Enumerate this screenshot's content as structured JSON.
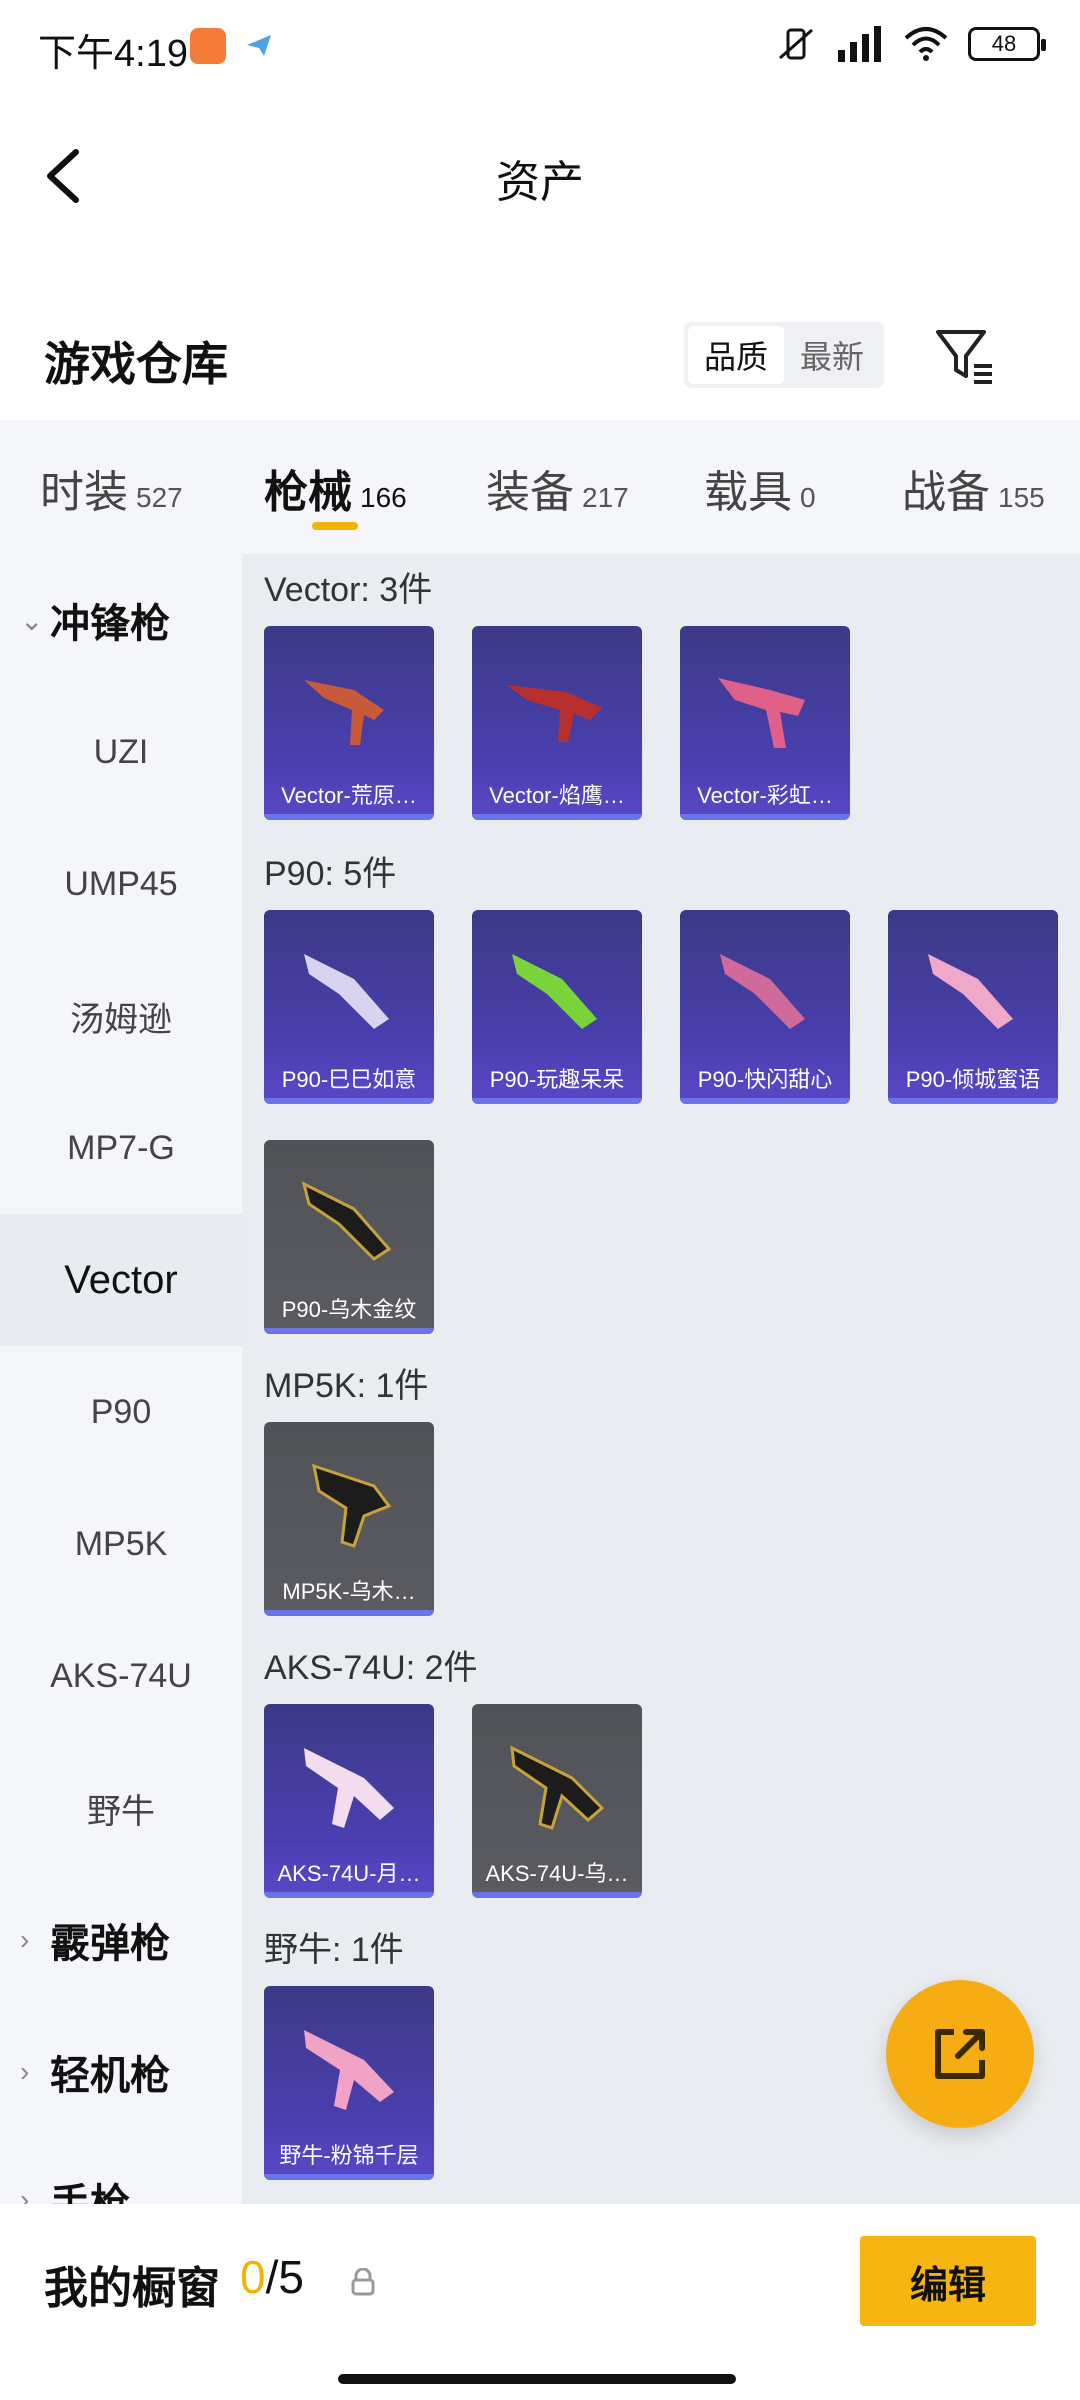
{
  "status": {
    "time": "下午4:19",
    "battery": "48"
  },
  "header": {
    "title": "资产"
  },
  "warehouse": {
    "title": "游戏仓库",
    "sort_options": [
      "品质",
      "最新"
    ],
    "active_sort": "品质"
  },
  "tabs": [
    {
      "label": "时装",
      "count": "527"
    },
    {
      "label": "枪械",
      "count": "166",
      "active": true
    },
    {
      "label": "装备",
      "count": "217"
    },
    {
      "label": "载具",
      "count": "0"
    },
    {
      "label": "战备",
      "count": "155"
    }
  ],
  "sidebar": {
    "group_smg": "冲锋枪",
    "items": [
      "UZI",
      "UMP45",
      "汤姆逊",
      "MP7-G",
      "Vector",
      "P90",
      "MP5K",
      "AKS-74U",
      "野牛"
    ],
    "active_item": "Vector",
    "group_shotgun": "霰弹枪",
    "group_lmg": "轻机枪",
    "group_pistol": "手枪"
  },
  "sections": [
    {
      "title": "Vector: 3件",
      "items": [
        "Vector-荒原…",
        "Vector-焰鹰…",
        "Vector-彩虹…"
      ]
    },
    {
      "title": "P90: 5件",
      "items": [
        "P90-巳巳如意",
        "P90-玩趣呆呆",
        "P90-快闪甜心",
        "P90-倾城蜜语",
        "P90-乌木金纹"
      ]
    },
    {
      "title": "MP5K: 1件",
      "items": [
        "MP5K-乌木…"
      ]
    },
    {
      "title": "AKS-74U: 2件",
      "items": [
        "AKS-74U-月…",
        "AKS-74U-乌…"
      ]
    },
    {
      "title": "野牛: 1件",
      "items": [
        "野牛-粉锦千层"
      ]
    }
  ],
  "bottom": {
    "label": "我的橱窗",
    "used": "0",
    "separator": "/",
    "total": "5",
    "edit_label": "编辑"
  },
  "icons": {
    "back": "back-arrow-icon",
    "filter": "filter-icon",
    "fab": "share-external-icon",
    "lock": "lock-icon"
  },
  "colors": {
    "accent": "#f5b301",
    "card_purple": "#4a3fb0",
    "card_gray": "#55575c"
  }
}
